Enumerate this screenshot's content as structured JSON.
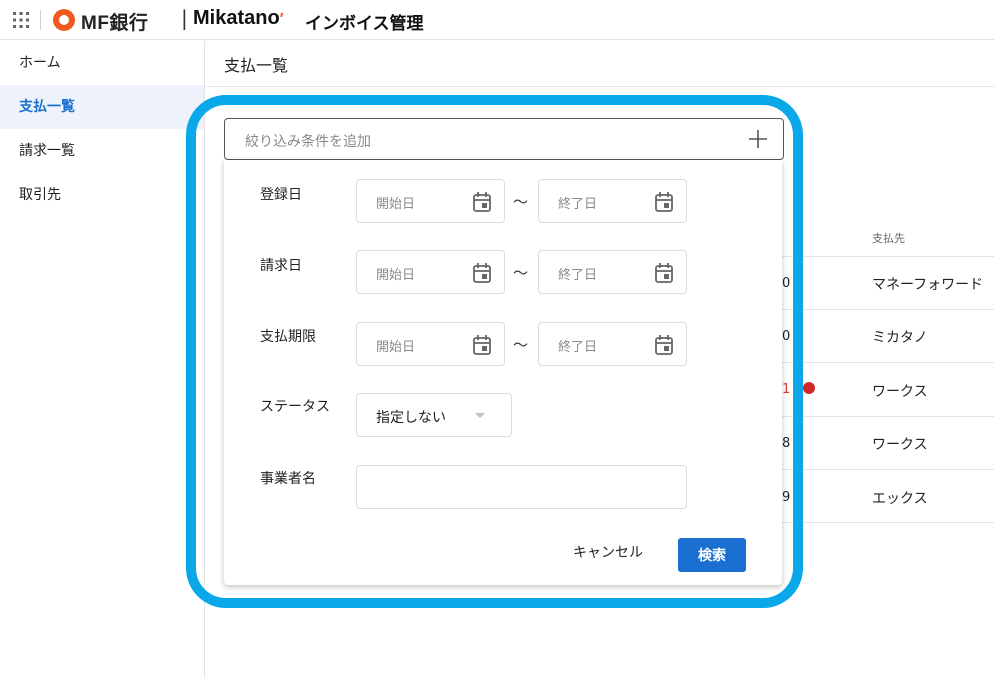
{
  "header": {
    "bank_name": "MF銀行",
    "separator": "|",
    "brand": "Mikatano",
    "brand_mark": "′",
    "product": "インボイス管理",
    "logo_color": "#f05a22"
  },
  "sidebar": {
    "items": [
      {
        "label": "ホーム"
      },
      {
        "label": "支払一覧"
      },
      {
        "label": "請求一覧"
      },
      {
        "label": "取引先"
      }
    ],
    "active_index": 1,
    "active_color": "#1b6fd0"
  },
  "main": {
    "title": "支払一覧",
    "table": {
      "column_header": "支払先",
      "rows": [
        {
          "num": "0",
          "payee": "マネーフォワード"
        },
        {
          "num": "0",
          "payee": "ミカタノ"
        },
        {
          "num": "1",
          "payee": "ワークス",
          "alert": true
        },
        {
          "num": "8",
          "payee": "ワークス"
        },
        {
          "num": "9",
          "payee": "エックス"
        }
      ]
    }
  },
  "filter": {
    "placeholder": "絞り込み条件を追加",
    "add_icon": "plus-icon",
    "fields": {
      "registered": {
        "label": "登録日",
        "start": "開始日",
        "end": "終了日"
      },
      "invoiced": {
        "label": "請求日",
        "start": "開始日",
        "end": "終了日"
      },
      "due": {
        "label": "支払期限",
        "start": "開始日",
        "end": "終了日"
      },
      "status": {
        "label": "ステータス",
        "value": "指定しない"
      },
      "business": {
        "label": "事業者名",
        "value": ""
      }
    },
    "range_separator": "〜",
    "cancel_label": "キャンセル",
    "search_label": "検索",
    "primary_color": "#1b6fd0",
    "highlight_color": "#0aa8e8"
  }
}
